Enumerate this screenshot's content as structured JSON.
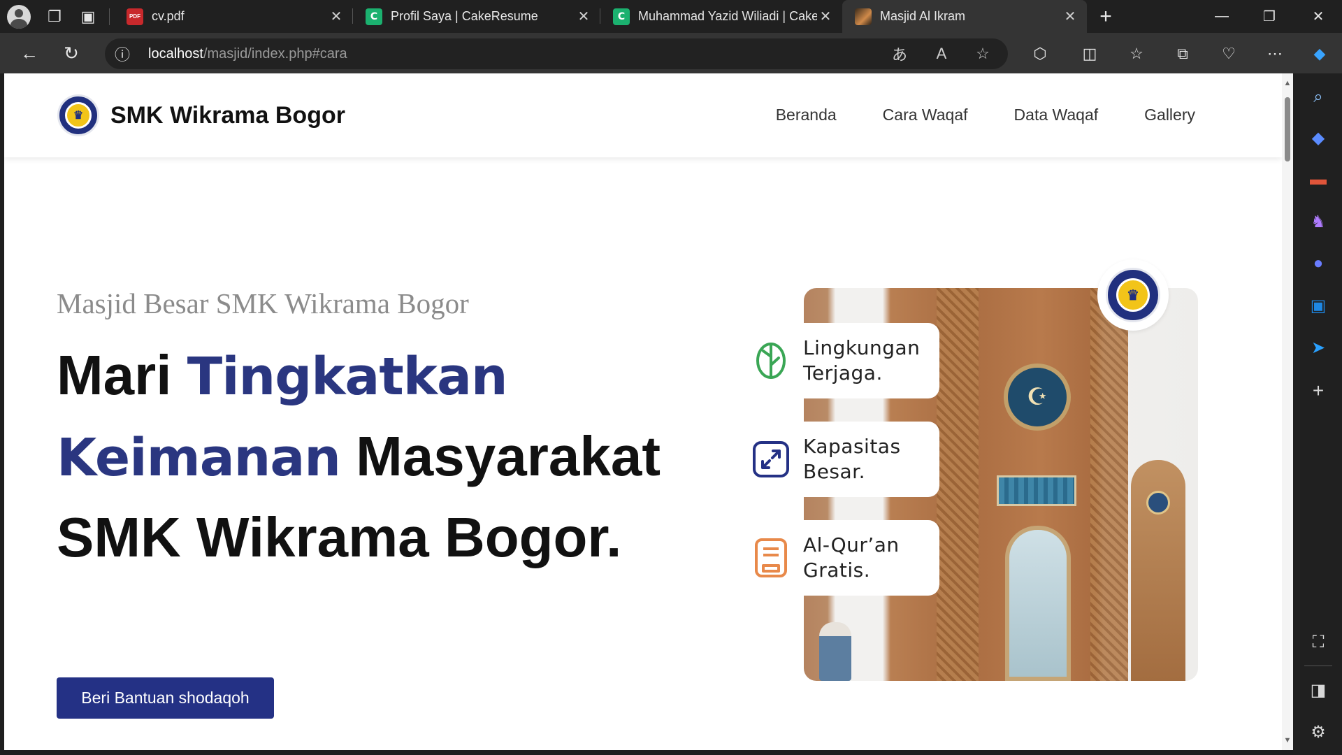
{
  "browser": {
    "tabs": [
      {
        "title": "cv.pdf",
        "icon": "pdf-icon"
      },
      {
        "title": "Profil Saya | CakeResume",
        "icon": "cakeresume-icon"
      },
      {
        "title": "Muhammad Yazid Wiliadi | Cake",
        "icon": "cakeresume-icon"
      },
      {
        "title": "Masjid Al Ikram",
        "icon": "mosque-thumbnail-icon",
        "active": true
      }
    ],
    "address": {
      "host": "localhost",
      "path": "/masjid/index.php#cara"
    }
  },
  "site": {
    "brand": "SMK Wikrama Bogor",
    "nav": [
      "Beranda",
      "Cara Waqaf",
      "Data Waqaf",
      "Gallery"
    ]
  },
  "hero": {
    "subtitle": "Masjid Besar SMK Wikrama Bogor",
    "h1_a": "Mari ",
    "h1_accent": "Tingkatkan Keimanan",
    "h1_b": " Masyarakat SMK Wikrama Bogor.",
    "cta": "Beri Bantuan shodaqoh"
  },
  "features": [
    {
      "line1": "Lingkungan",
      "line2": "Terjaga.",
      "icon": "leaf-icon",
      "color": "#3aa655"
    },
    {
      "line1": "Kapasitas",
      "line2": "Besar.",
      "icon": "expand-icon",
      "color": "#243185"
    },
    {
      "line1": "Al-Qur’an",
      "line2": "Gratis.",
      "icon": "book-icon",
      "color": "#e8894a"
    }
  ],
  "colors": {
    "accent": "#243185",
    "subtitle": "#8b8b8b"
  }
}
